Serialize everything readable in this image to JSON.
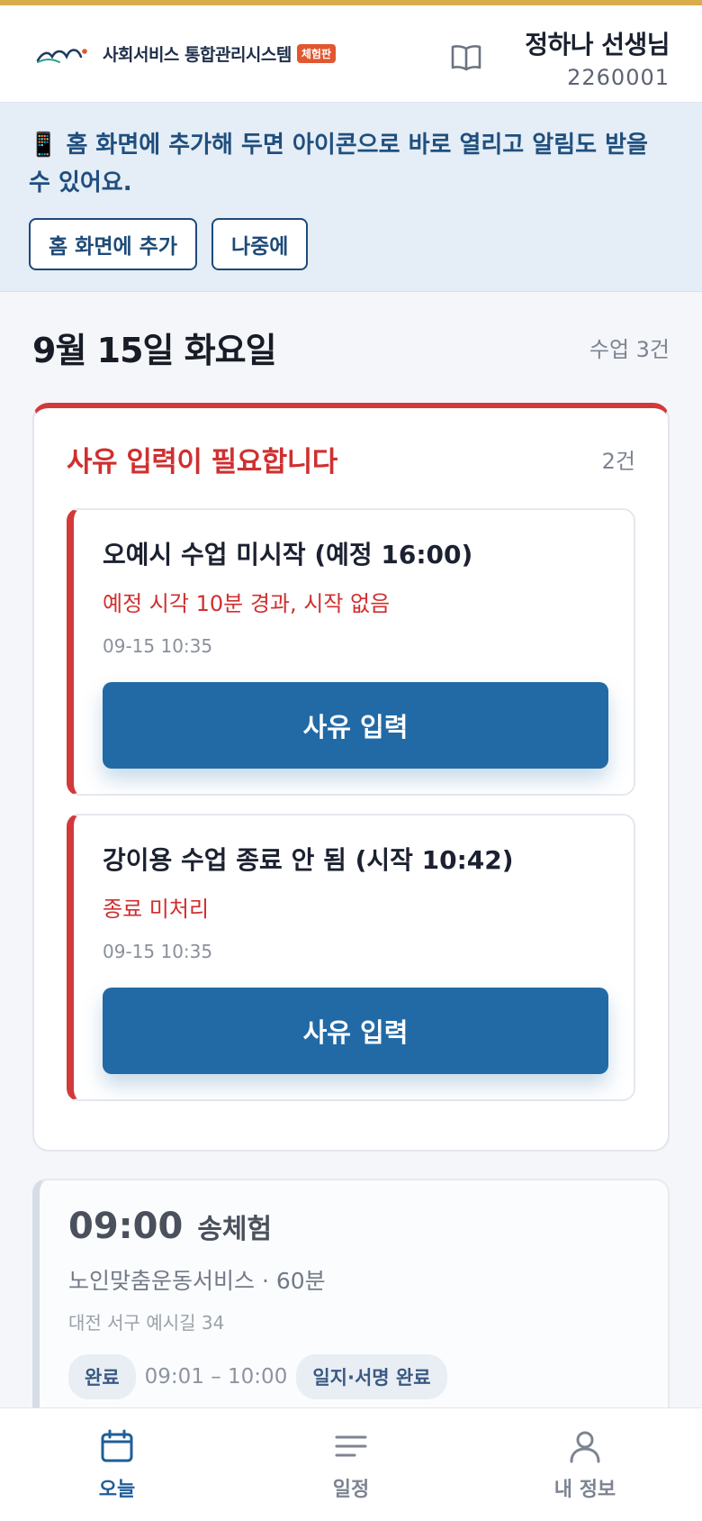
{
  "header": {
    "brand": "사회서비스 통합관리시스템",
    "badge": "체험판",
    "user_name": "정하나 선생님",
    "user_id": "2260001"
  },
  "banner": {
    "icon": "📱",
    "text": "홈 화면에 추가해 두면 아이콘으로 바로 열리고 알림도 받을 수 있어요.",
    "add_label": "홈 화면에 추가",
    "later_label": "나중에"
  },
  "today": {
    "date": "9월 15일 화요일",
    "class_count": "수업 3건"
  },
  "alerts": {
    "title": "사유 입력이 필요합니다",
    "count": "2건",
    "items": [
      {
        "title": "오예시 수업 미시작 (예정 16:00)",
        "subtitle": "예정 시각 10분 경과, 시작 없음",
        "time": "09-15 10:35",
        "button": "사유 입력"
      },
      {
        "title": "강이용 수업 종료 안 됨 (시작 10:42)",
        "subtitle": "종료 미처리",
        "time": "09-15 10:35",
        "button": "사유 입력"
      }
    ]
  },
  "schedule": [
    {
      "time": "09:00",
      "name": "송체험",
      "service": "노인맞춤운동서비스 · 60분",
      "address": "대전 서구 예시길 34",
      "status": "완료",
      "range": "09:01 – 10:00",
      "log_status": "일지·서명 완료"
    }
  ],
  "nav": {
    "today": "오늘",
    "schedule": "일정",
    "profile": "내 정보"
  },
  "colors": {
    "accent": "#d8ad4b",
    "primary": "#226aa5",
    "alert": "#d23a3a",
    "brand_badge": "#e2572f"
  }
}
